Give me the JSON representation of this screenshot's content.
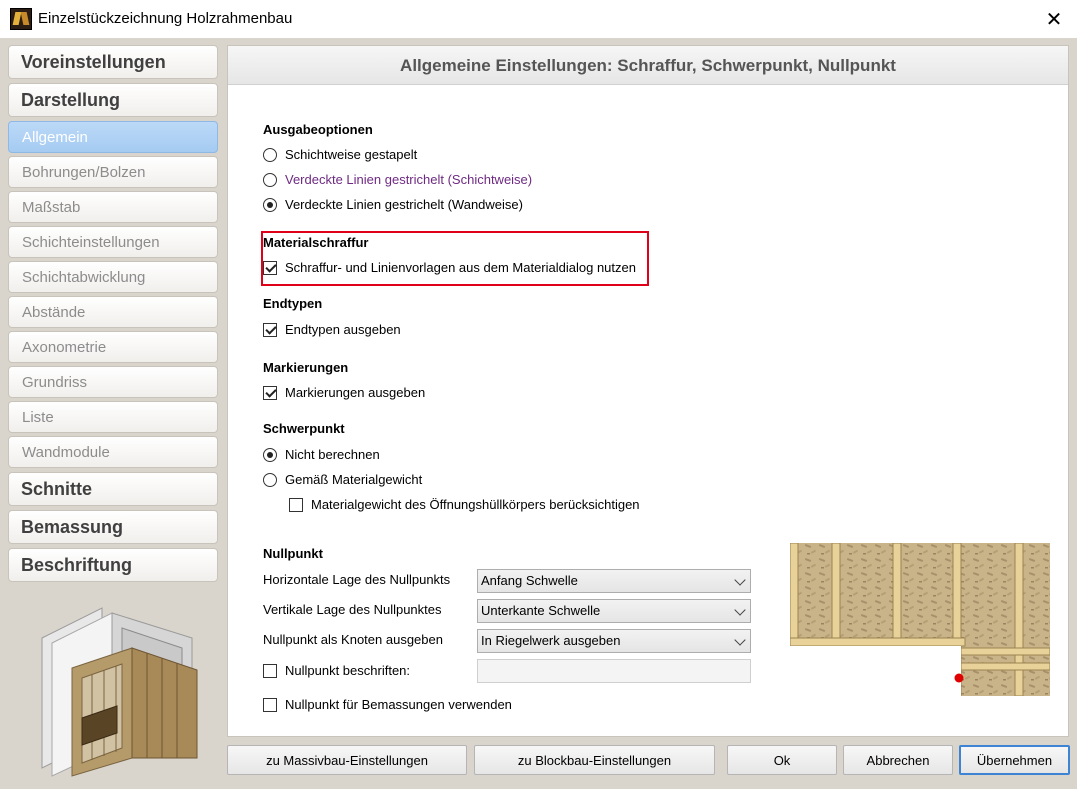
{
  "window": {
    "title": "Einzelstückzeichnung Holzrahmenbau",
    "close_glyph": "✕"
  },
  "sidebar": {
    "categories": {
      "voreinstellungen": "Voreinstellungen",
      "darstellung": "Darstellung",
      "schnitte": "Schnitte",
      "bemassung": "Bemassung",
      "beschriftung": "Beschriftung"
    },
    "subitems": [
      "Allgemein",
      "Bohrungen/Bolzen",
      "Maßstab",
      "Schichteinstellungen",
      "Schichtabwicklung",
      "Abstände",
      "Axonometrie",
      "Grundriss",
      "Liste",
      "Wandmodule"
    ],
    "active_subitem": "Allgemein"
  },
  "panel": {
    "header": "Allgemeine Einstellungen: Schraffur, Schwerpunkt, Nullpunkt",
    "ausgabeoptionen": {
      "title": "Ausgabeoptionen",
      "options": [
        "Schichtweise gestapelt",
        "Verdeckte Linien gestrichelt (Schichtweise)",
        "Verdeckte Linien gestrichelt (Wandweise)"
      ],
      "selected": "Verdeckte Linien gestrichelt (Wandweise)"
    },
    "materialschraffur": {
      "title": "Materialschraffur",
      "checkbox": "Schraffur- und Linienvorlagen aus dem Materialdialog nutzen",
      "checked": true
    },
    "endtypen": {
      "title": "Endtypen",
      "checkbox": "Endtypen ausgeben",
      "checked": true
    },
    "markierungen": {
      "title": "Markierungen",
      "checkbox": "Markierungen ausgeben",
      "checked": true
    },
    "schwerpunkt": {
      "title": "Schwerpunkt",
      "options": [
        "Nicht berechnen",
        "Gemäß Materialgewicht"
      ],
      "selected": "Nicht berechnen",
      "sub_checkbox": "Materialgewicht des Öffnungshüllkörpers berücksichtigen",
      "sub_checked": false
    },
    "nullpunkt": {
      "title": "Nullpunkt",
      "horizontal_label": "Horizontale Lage des Nullpunkts",
      "horizontal_value": "Anfang Schwelle",
      "vertical_label": "Vertikale Lage des Nullpunktes",
      "vertical_value": "Unterkante Schwelle",
      "knoten_label": "Nullpunkt als Knoten ausgeben",
      "knoten_value": "In Riegelwerk ausgeben",
      "beschriften_label": "Nullpunkt beschriften:",
      "beschriften_checked": false,
      "beschriften_value": "",
      "bemassung_label": "Nullpunkt für Bemassungen verwenden",
      "bemassung_checked": false
    }
  },
  "buttons": {
    "massivbau": "zu Massivbau-Einstellungen",
    "blockbau": "zu Blockbau-Einstellungen",
    "ok": "Ok",
    "abbrechen": "Abbrechen",
    "uebernehmen": "Übernehmen"
  },
  "colors": {
    "highlight": "#e0001a",
    "active_nav": "#a5cbf2",
    "purple_option": "#6e2a82",
    "nullpoint_marker": "#e00000"
  }
}
